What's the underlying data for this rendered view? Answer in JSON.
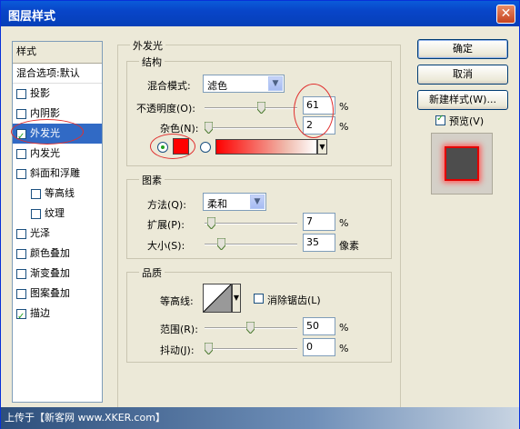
{
  "window": {
    "title": "图层样式",
    "close_glyph": "✕"
  },
  "styles_list": {
    "header": "样式",
    "blend_options": "混合选项:默认",
    "items": [
      {
        "label": "投影",
        "checked": false,
        "sub": false
      },
      {
        "label": "内阴影",
        "checked": false,
        "sub": false
      },
      {
        "label": "外发光",
        "checked": true,
        "sub": false,
        "selected": true
      },
      {
        "label": "内发光",
        "checked": false,
        "sub": false
      },
      {
        "label": "斜面和浮雕",
        "checked": false,
        "sub": false
      },
      {
        "label": "等高线",
        "checked": false,
        "sub": true
      },
      {
        "label": "纹理",
        "checked": false,
        "sub": true
      },
      {
        "label": "光泽",
        "checked": false,
        "sub": false
      },
      {
        "label": "颜色叠加",
        "checked": false,
        "sub": false
      },
      {
        "label": "渐变叠加",
        "checked": false,
        "sub": false
      },
      {
        "label": "图案叠加",
        "checked": false,
        "sub": false
      },
      {
        "label": "描边",
        "checked": true,
        "sub": false
      }
    ]
  },
  "outer_glow": {
    "section_title": "外发光",
    "structure": {
      "title": "结构",
      "blend_mode_label": "混合模式:",
      "blend_mode_value": "滤色",
      "opacity_label": "不透明度(O):",
      "opacity_value": "61",
      "noise_label": "杂色(N):",
      "noise_value": "2",
      "percent": "%",
      "glow_color": "#ff0000"
    },
    "elements": {
      "title": "图素",
      "method_label": "方法(Q):",
      "method_value": "柔和",
      "spread_label": "扩展(P):",
      "spread_value": "7",
      "size_label": "大小(S):",
      "size_value": "35",
      "pixels": "像素",
      "percent": "%"
    },
    "quality": {
      "title": "品质",
      "contour_label": "等高线:",
      "anti_alias_label": "消除锯齿(L)",
      "range_label": "范围(R):",
      "range_value": "50",
      "jitter_label": "抖动(J):",
      "jitter_value": "0",
      "percent": "%"
    }
  },
  "buttons": {
    "ok": "确定",
    "cancel": "取消",
    "new_style": "新建样式(W)...",
    "preview_label": "预览(V)"
  },
  "watermark": "上传于【新客网 www.XKER.com】"
}
